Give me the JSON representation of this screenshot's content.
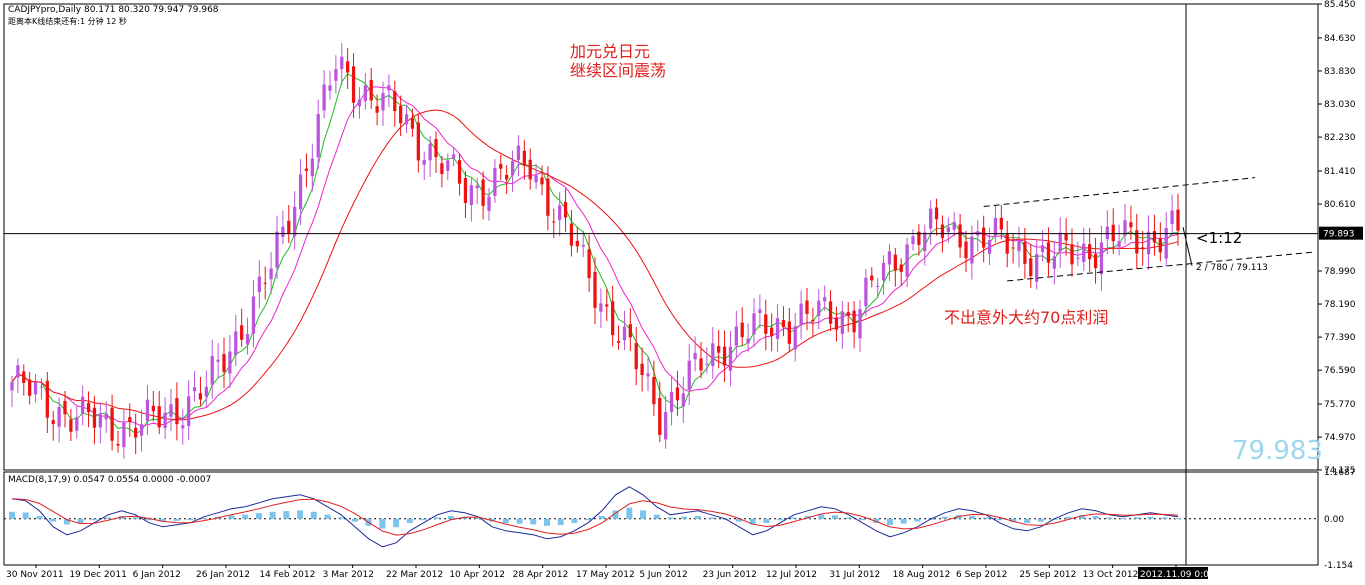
{
  "header": {
    "symbol_line": "CADJPYpro,Daily  80.171 80.320 79.947 79.968",
    "countdown_line": "距离本K线结束还有:1 分钟 12 秒"
  },
  "annotations": {
    "title_line1": "加元兑日元",
    "title_line2": "继续区间震荡",
    "profit_note": "不出意外大约70点利润",
    "ratio_label": "<1:12",
    "fib_label": "2 / 780 / 79.113"
  },
  "big_price": "79.983",
  "colors": {
    "bull_candle": "#bb55dd",
    "bear_candle": "#ee1111",
    "ma_green": "#22bb22",
    "ma_pink": "#ee22cc",
    "ma_red": "#ee1111",
    "macd_hist": "#7cc4ec",
    "macd_line": "#1c2a9c",
    "signal_line": "#e02020"
  },
  "chart_data": [
    {
      "type": "candlestick",
      "symbol": "CADJPYpro",
      "timeframe": "Daily",
      "ylim": [
        74.175,
        85.45
      ],
      "y_ticks": [
        "85.450",
        "84.630",
        "83.830",
        "83.030",
        "82.230",
        "81.410",
        "80.610",
        "79.893",
        "78.990",
        "78.190",
        "77.390",
        "76.590",
        "75.770",
        "74.970",
        "74.175"
      ],
      "current_price": "79.893",
      "x_ticks": [
        "30 Nov 2011",
        "19 Dec 2011",
        "6 Jan 2012",
        "26 Jan 2012",
        "14 Feb 2012",
        "3 Mar 2012",
        "22 Mar 2012",
        "10 Apr 2012",
        "28 Apr 2012",
        "17 May 2012",
        "5 Jun 2012",
        "23 Jun 2012",
        "12 Jul 2012",
        "31 Jul 2012",
        "18 Aug 2012",
        "6 Sep 2012",
        "25 Sep 2012",
        "13 Oct 2012",
        "2012.11.09 0:00"
      ],
      "key_points": [
        {
          "date": "30 Nov 2011",
          "close": 76.3
        },
        {
          "date": "19 Dec 2011",
          "close": 75.4
        },
        {
          "date": "6 Jan 2012",
          "close": 75.2
        },
        {
          "date": "26 Jan 2012",
          "close": 76.1
        },
        {
          "date": "14 Feb 2012",
          "close": 79.0
        },
        {
          "date": "3 Mar 2012",
          "close": 83.9
        },
        {
          "date": "22 Mar 2012",
          "close": 82.7
        },
        {
          "date": "10 Apr 2012",
          "close": 80.9
        },
        {
          "date": "28 Apr 2012",
          "close": 81.6
        },
        {
          "date": "17 May 2012",
          "close": 78.6
        },
        {
          "date": "5 Jun 2012",
          "close": 75.6
        },
        {
          "date": "23 Jun 2012",
          "close": 77.3
        },
        {
          "date": "12 Jul 2012",
          "close": 77.8
        },
        {
          "date": "31 Jul 2012",
          "close": 78.0
        },
        {
          "date": "18 Aug 2012",
          "close": 80.0
        },
        {
          "date": "6 Sep 2012",
          "close": 79.8
        },
        {
          "date": "25 Sep 2012",
          "close": 79.3
        },
        {
          "date": "13 Oct 2012",
          "close": 79.7
        },
        {
          "date": "2012.11.09 0:00",
          "close": 79.968
        }
      ],
      "moving_averages": [
        "green",
        "pink",
        "red"
      ]
    },
    {
      "type": "macd",
      "title": "MACD(8,17,9) 0.0547 0.0554 0.0000 -0.0007",
      "ylim": [
        -1.154,
        1.1687
      ],
      "y_ticks": [
        "1.1687",
        "0.00",
        "-1.154"
      ],
      "hist_shape": [
        0.5,
        0.45,
        0.2,
        -0.2,
        -0.4,
        -0.3,
        -0.1,
        0.1,
        0.2,
        0.1,
        -0.1,
        -0.2,
        -0.15,
        -0.1,
        0.05,
        0.15,
        0.25,
        0.3,
        0.4,
        0.5,
        0.55,
        0.6,
        0.5,
        0.3,
        0.1,
        -0.2,
        -0.5,
        -0.7,
        -0.6,
        -0.3,
        -0.1,
        0.1,
        0.2,
        0.15,
        0.05,
        -0.2,
        -0.3,
        -0.35,
        -0.4,
        -0.5,
        -0.45,
        -0.3,
        -0.1,
        0.2,
        0.6,
        0.8,
        0.6,
        0.3,
        0.1,
        0.15,
        0.2,
        0.1,
        0.0,
        -0.2,
        -0.4,
        -0.3,
        -0.1,
        0.1,
        0.2,
        0.3,
        0.25,
        0.1,
        -0.1,
        -0.3,
        -0.45,
        -0.35,
        -0.2,
        0.0,
        0.15,
        0.25,
        0.2,
        0.1,
        -0.1,
        -0.25,
        -0.3,
        -0.2,
        0.0,
        0.15,
        0.25,
        0.2,
        0.1,
        0.05,
        0.1,
        0.15,
        0.1,
        0.05
      ]
    }
  ]
}
